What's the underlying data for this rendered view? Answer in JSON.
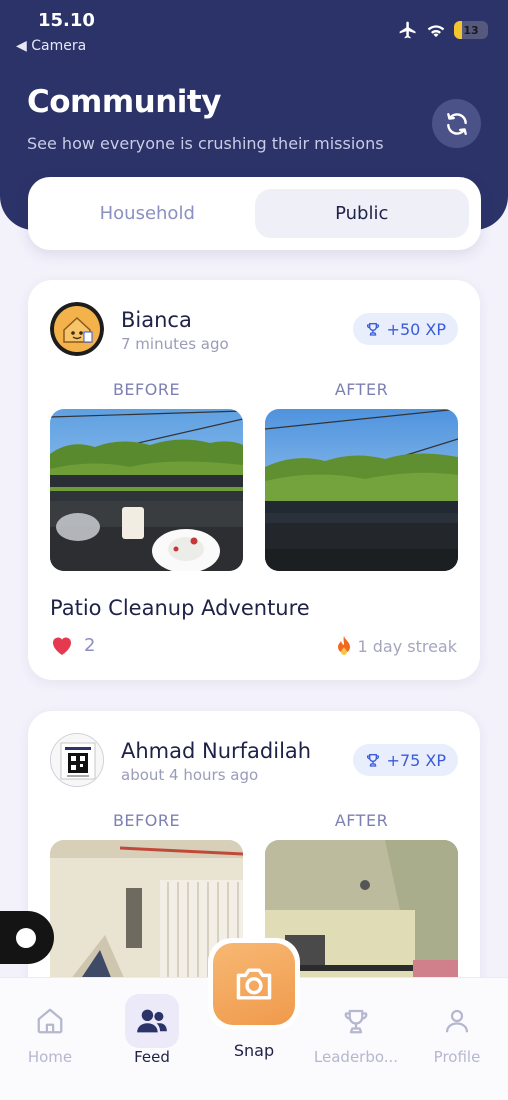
{
  "status_bar": {
    "time": "15.10",
    "back_label": "◀ Camera",
    "battery": "13"
  },
  "header": {
    "title": "Community",
    "subtitle": "See how everyone is crushing their missions"
  },
  "tabs": [
    {
      "label": "Household",
      "active": false
    },
    {
      "label": "Public",
      "active": true
    }
  ],
  "posts": [
    {
      "user": "Bianca",
      "time": "7 minutes ago",
      "xp": "+50 XP",
      "before_label": "BEFORE",
      "after_label": "AFTER",
      "mission": "Patio Cleanup Adventure",
      "likes": "2",
      "streak": "1 day streak"
    },
    {
      "user": "Ahmad Nurfadilah",
      "time": "about 4 hours ago",
      "xp": "+75 XP",
      "before_label": "BEFORE",
      "after_label": "AFTER"
    }
  ],
  "nav": {
    "home": "Home",
    "feed": "Feed",
    "snap": "Snap",
    "leaderboard": "Leaderbo...",
    "profile": "Profile"
  },
  "colors": {
    "header_bg": "#2b3369",
    "accent_xp": "#3a5bd9",
    "snap_orange": "#f09a4c",
    "heart": "#e53950"
  }
}
